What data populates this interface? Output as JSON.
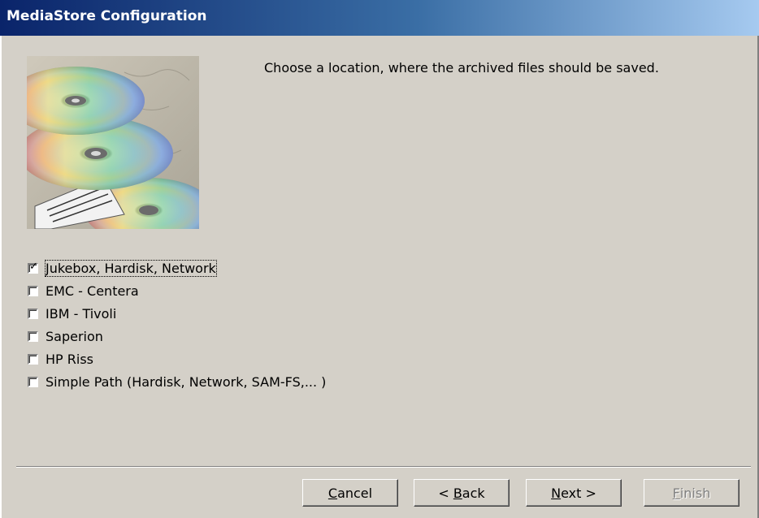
{
  "window": {
    "title": "MediaStore Configuration"
  },
  "instruction": "Choose a location, where the archived files should be saved.",
  "options": [
    {
      "label": "Jukebox, Hardisk, Network",
      "checked": true
    },
    {
      "label": "EMC - Centera",
      "checked": false
    },
    {
      "label": "IBM - Tivoli",
      "checked": false
    },
    {
      "label": "Saperion",
      "checked": false
    },
    {
      "label": "HP Riss",
      "checked": false
    },
    {
      "label": "Simple Path (Hardisk, Network, SAM-FS,... )",
      "checked": false
    }
  ],
  "buttons": {
    "cancel": {
      "pre": "",
      "key": "C",
      "post": "ancel"
    },
    "back": {
      "pre": "< ",
      "key": "B",
      "post": "ack"
    },
    "next": {
      "pre": "",
      "key": "N",
      "post": "ext >"
    },
    "finish": {
      "pre": "",
      "key": "F",
      "post": "inish",
      "enabled": false
    }
  },
  "icons": {
    "picture": "cd-discs-image",
    "check": "check-icon"
  }
}
